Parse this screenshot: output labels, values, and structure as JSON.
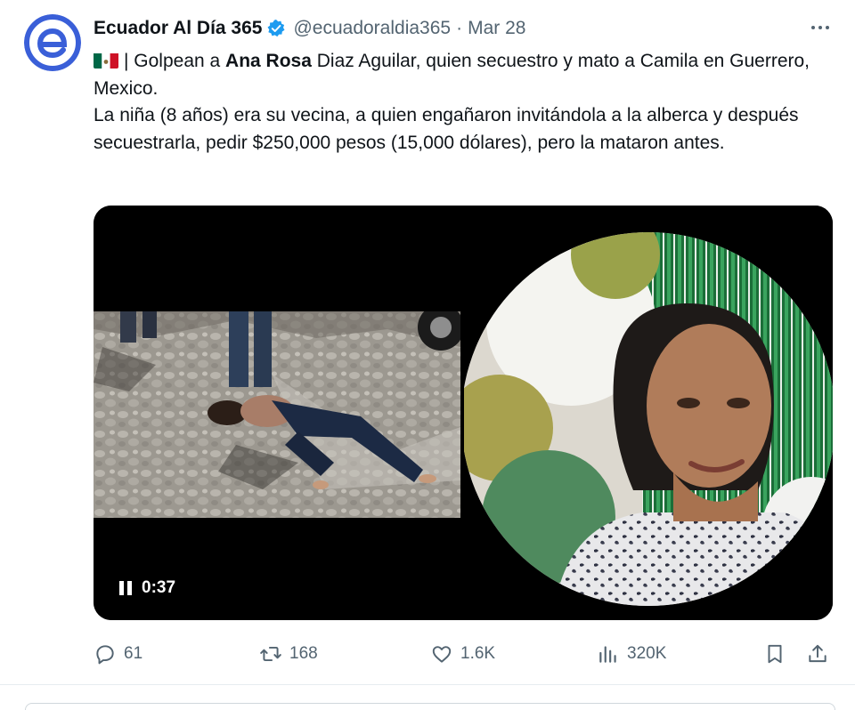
{
  "tweet": {
    "author_name": "Ecuador Al Día 365",
    "handle": "@ecuadoraldia365",
    "separator": "·",
    "date": "Mar 28",
    "flag_emoji": "mexico-flag",
    "text_parts": {
      "p1_prefix": "| Golpean a ",
      "p1_bold": "Ana Rosa",
      "p1_suffix": " Diaz Aguilar, quien secuestro y mato a Camila en Guerrero, Mexico.",
      "p2": "La niña (8 años) era su vecina, a quien engañaron invitándola a la alberca y después secuestrarla, pedir $250,000 pesos (15,000 dólares), pero la mataron antes."
    },
    "video": {
      "time": "0:37"
    },
    "stats": {
      "replies": "61",
      "retweets": "168",
      "likes": "1.6K",
      "views": "320K"
    }
  },
  "colors": {
    "text": "#0f1419",
    "secondary": "#536471",
    "verified": "#1d9bf0",
    "brand_logo": "#3a5fd8"
  },
  "icons": [
    "verified-badge-icon",
    "more-icon",
    "pause-icon",
    "reply-icon",
    "retweet-icon",
    "like-icon",
    "views-icon",
    "bookmark-icon",
    "share-icon"
  ]
}
